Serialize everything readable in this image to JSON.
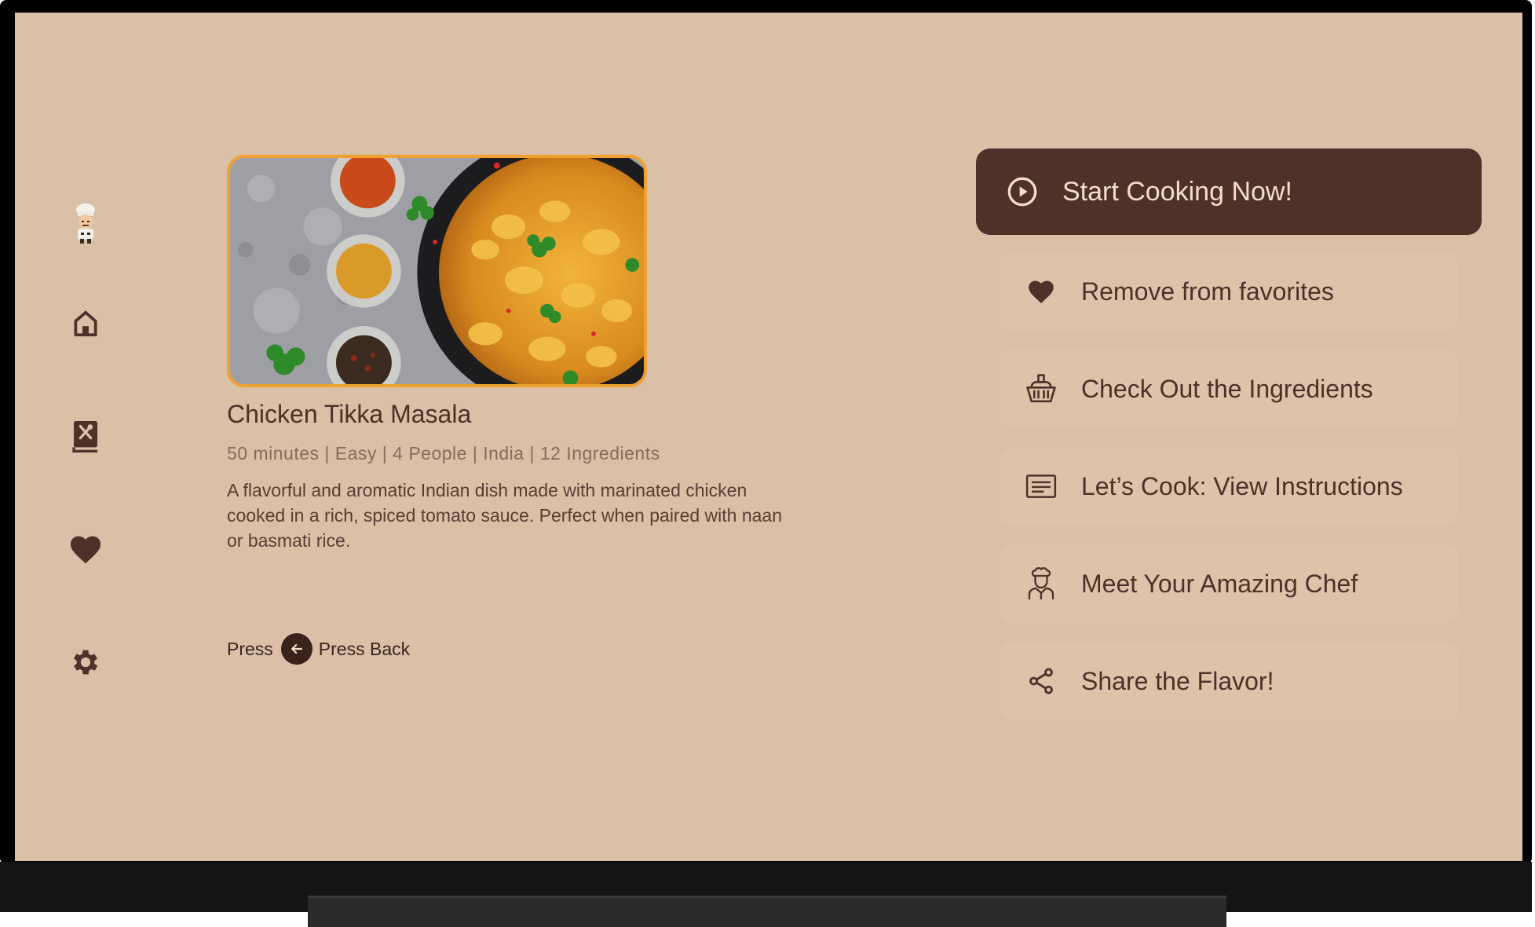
{
  "colors": {
    "background": "#d9c0a6",
    "primary_button": "#4e322a",
    "primary_text": "#f3dfc8",
    "secondary_button": "#dcc4ab",
    "text_dark": "#4f3029",
    "text_muted": "#8a6a5e",
    "image_border": "#f0a030"
  },
  "sidebar": {
    "items": [
      {
        "name": "chef-avatar",
        "icon": "chef-avatar-icon"
      },
      {
        "name": "home",
        "icon": "home-icon"
      },
      {
        "name": "recipes",
        "icon": "recipe-book-icon"
      },
      {
        "name": "favorites",
        "icon": "heart-icon"
      },
      {
        "name": "settings",
        "icon": "gear-icon"
      }
    ]
  },
  "recipe": {
    "title": "Chicken Tikka Masala",
    "meta": "50 minutes | Easy | 4 People  | India | 12 Ingredients",
    "description": "A flavorful and aromatic Indian dish made with marinated chicken cooked in a rich, spiced tomato sauce. Perfect when paired with naan or basmati rice."
  },
  "hint": {
    "press": "Press",
    "back": "Press Back"
  },
  "actions": {
    "primary": {
      "label": "Start Cooking Now!",
      "icon": "play-circle-icon"
    },
    "items": [
      {
        "label": "Remove from favorites",
        "icon": "heart-icon"
      },
      {
        "label": "Check Out the Ingredients",
        "icon": "basket-icon"
      },
      {
        "label": "Let’s Cook: View Instructions",
        "icon": "instructions-icon"
      },
      {
        "label": "Meet Your Amazing Chef",
        "icon": "chef-icon"
      },
      {
        "label": "Share the Flavor!",
        "icon": "share-icon"
      }
    ]
  }
}
